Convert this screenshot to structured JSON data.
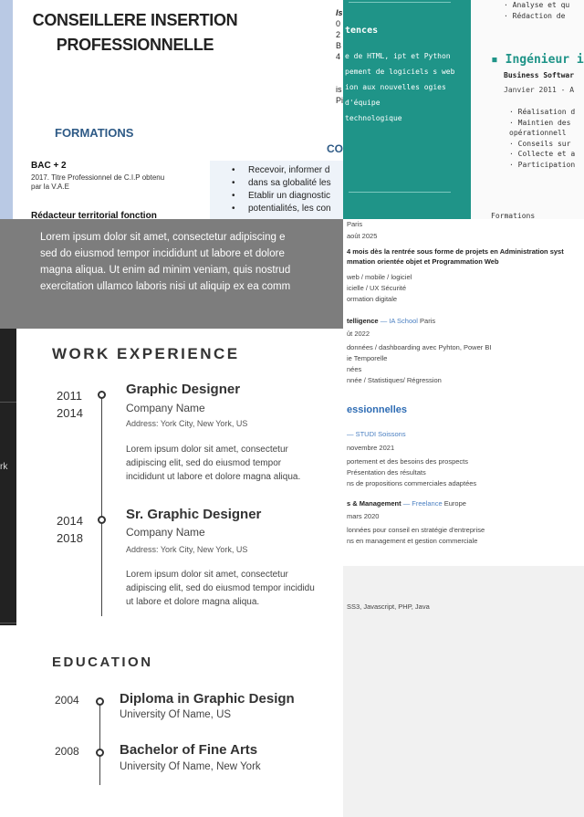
{
  "doc1": {
    "title": "CONSEILLERE INSERTION PROFESSIONNELLE",
    "formations_heading": "FORMATIONS",
    "bac": "BAC + 2",
    "bac_desc": "2017. Titre Professionnel de C.I.P obtenu par la V.A.E",
    "redacteur": "Rédacteur territorial fonction",
    "col2_lines": [
      "Is",
      "0",
      "2",
      "B",
      "4",
      "is",
      "Pi"
    ],
    "co_heading": "CO",
    "bullets": [
      "Recevoir, informer d",
      "dans sa globalité les",
      "Etablir un diagnostic",
      "potentialités, les con"
    ]
  },
  "doc2": {
    "heading": "tences",
    "skills": [
      "e de HTML, ipt et Python",
      "pement de logiciels s web",
      "ion aux nouvelles ogies",
      "d'équipe",
      "technologique"
    ],
    "top_lines": [
      "· Analyse et qu",
      "· Rédaction de"
    ],
    "job_title": "▪ Ingénieur i",
    "company": "Business Softwar",
    "date": "Janvier 2011 - A",
    "tasks": [
      "· Réalisation d",
      "· Maintien des",
      "  opérationnell",
      "· Conseils sur",
      "· Collecte et a",
      "· Participation"
    ],
    "formations": "Formations"
  },
  "overlay": {
    "lines": [
      "Lorem ipsum dolor sit amet, consectetur adipiscing e",
      "sed do eiusmod tempor incididunt ut labore et dolore",
      "magna aliqua. Ut enim ad minim veniam, quis nostrud",
      "exercitation ullamco laboris nisi ut aliquip ex ea comm"
    ]
  },
  "doc3": {
    "rows": [
      {
        "text": "Paris",
        "style": ""
      },
      {
        "text": " août 2025",
        "style": ""
      },
      {
        "text": "4 mois dès la rentrée sous forme de projets en Administration syst",
        "style": "bold"
      },
      {
        "text": "mmation orientée objet et Programmation Web",
        "style": "bold"
      },
      {
        "text": "web / mobile / logiciel",
        "style": ""
      },
      {
        "text": "icielle / UX Sécurité",
        "style": ""
      },
      {
        "text": "ormation digitale",
        "style": ""
      },
      {
        "text": "telligence — IA School Paris",
        "style": "mixed"
      },
      {
        "text": "ût 2022",
        "style": ""
      },
      {
        "text": "données / dashboarding avec Pyhton, Power BI",
        "style": ""
      },
      {
        "text": "ie Temporelle",
        "style": ""
      },
      {
        "text": "nées",
        "style": ""
      },
      {
        "text": "nnée / Statistiques/ Régression",
        "style": ""
      }
    ],
    "section": "essionnelles",
    "rows2": [
      {
        "text": "— STUDI Soissons",
        "style": "accent"
      },
      {
        "text": " novembre 2021",
        "style": ""
      },
      {
        "text": "portement et des besoins des prospects",
        "style": ""
      },
      {
        "text": "Présentation des résultats",
        "style": ""
      },
      {
        "text": "ns de propositions commerciales adaptées",
        "style": ""
      },
      {
        "text": "s & Management — Freelance Europe",
        "style": "mixed2"
      },
      {
        "text": " mars 2020",
        "style": ""
      },
      {
        "text": "lonnées pour conseil en stratégie d'entreprise",
        "style": ""
      },
      {
        "text": "ns en management et gestion commerciale",
        "style": ""
      }
    ],
    "tech": "SS3, Javascript, PHP, Java",
    "ia_bold": "telligence",
    "ia_accent": " — IA School",
    "ia_rest": " Paris",
    "mgmt_bold": "s & Management",
    "mgmt_accent": " — Freelance",
    "mgmt_rest": " Europe"
  },
  "resume": {
    "sidebar_letter": "rk",
    "work_heading": "WORK EXPERIENCE",
    "jobs": [
      {
        "start": "2011",
        "end": "2014",
        "title": "Graphic Designer",
        "company": "Company Name",
        "address": "Address: York City, New York, US",
        "desc": [
          "Lorem ipsum dolor sit amet, consectetur",
          "adipiscing elit, sed do eiusmod tempor",
          "incididunt ut labore et dolore magna aliqua."
        ]
      },
      {
        "start": "2014",
        "end": "2018",
        "title": "Sr. Graphic Designer",
        "company": "Company Name",
        "address": "Address: York City, New York, US",
        "desc": [
          "Lorem ipsum dolor sit amet, consectetur",
          "adipiscing elit, sed do eiusmod tempor incididu",
          "ut labore et dolore magna aliqua."
        ]
      }
    ],
    "education_heading": "EDUCATION",
    "education": [
      {
        "year": "2004",
        "title": "Diploma in Graphic Design",
        "school": "University Of Name, US"
      },
      {
        "year": "2008",
        "title": "Bachelor of Fine Arts",
        "school": "University Of Name, New York"
      }
    ]
  }
}
